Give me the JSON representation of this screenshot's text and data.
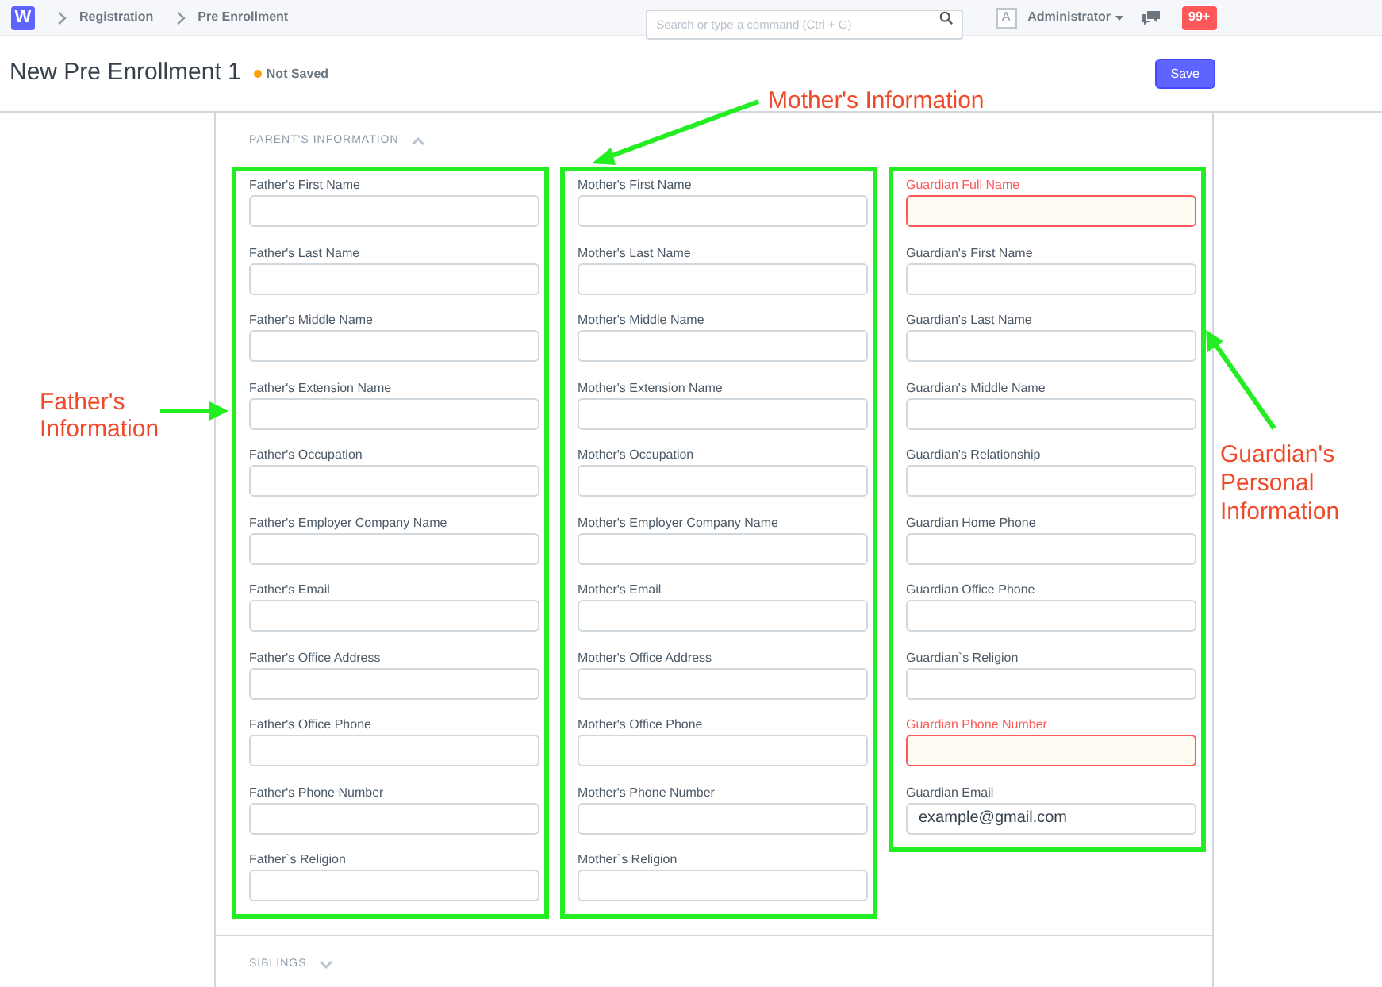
{
  "navbar": {
    "logo": "W",
    "breadcrumbs": [
      "Registration",
      "Pre Enrollment"
    ],
    "search": {
      "placeholder": "Search or type a command (Ctrl + G)"
    },
    "avatar": "A",
    "user": "Administrator",
    "notifications": "99+"
  },
  "page": {
    "title": "New Pre Enrollment 1",
    "status": "Not Saved",
    "save": "Save"
  },
  "sections": [
    {
      "title": "PARENT'S INFORMATION",
      "expanded": true,
      "columns": [
        {
          "fields": [
            {
              "label": "Father's First Name",
              "error": false
            },
            {
              "label": "Father's Last Name",
              "error": false
            },
            {
              "label": "Father's Middle Name",
              "error": false
            },
            {
              "label": "Father's Extension Name",
              "error": false
            },
            {
              "label": "Father's Occupation",
              "error": false
            },
            {
              "label": "Father's Employer Company Name",
              "error": false
            },
            {
              "label": "Father's Email",
              "error": false
            },
            {
              "label": "Father's Office Address",
              "error": false
            },
            {
              "label": "Father's Office Phone",
              "error": false
            },
            {
              "label": "Father's Phone Number",
              "error": false
            },
            {
              "label": "Father`s Religion",
              "error": false
            }
          ]
        },
        {
          "fields": [
            {
              "label": "Mother's First Name",
              "error": false
            },
            {
              "label": "Mother's Last Name",
              "error": false
            },
            {
              "label": "Mother's Middle Name",
              "error": false
            },
            {
              "label": "Mother's Extension Name",
              "error": false
            },
            {
              "label": "Mother's Occupation",
              "error": false
            },
            {
              "label": "Mother's Employer Company Name",
              "error": false
            },
            {
              "label": "Mother's Email",
              "error": false
            },
            {
              "label": "Mother's Office Address",
              "error": false
            },
            {
              "label": "Mother's Office Phone",
              "error": false
            },
            {
              "label": "Mother's Phone Number",
              "error": false
            },
            {
              "label": "Mother`s Religion",
              "error": false
            }
          ]
        },
        {
          "fields": [
            {
              "label": "Guardian Full Name",
              "error": true
            },
            {
              "label": "Guardian's First Name",
              "error": false
            },
            {
              "label": "Guardian's Last Name",
              "error": false
            },
            {
              "label": "Guardian's Middle Name",
              "error": false
            },
            {
              "label": "Guardian's Relationship",
              "error": false
            },
            {
              "label": "Guardian Home Phone",
              "error": false
            },
            {
              "label": "Guardian Office Phone",
              "error": false
            },
            {
              "label": "Guardian`s Religion",
              "error": false
            },
            {
              "label": "Guardian Phone Number",
              "error": true
            },
            {
              "label": "Guardian Email",
              "error": false,
              "value": "example@gmail.com"
            }
          ]
        }
      ]
    },
    {
      "title": "SIBLINGS",
      "expanded": false
    }
  ],
  "annotations": [
    {
      "text": "Mother's Information"
    },
    {
      "text": "Father's Information"
    },
    {
      "text": "Guardian's Personal Information"
    }
  ]
}
